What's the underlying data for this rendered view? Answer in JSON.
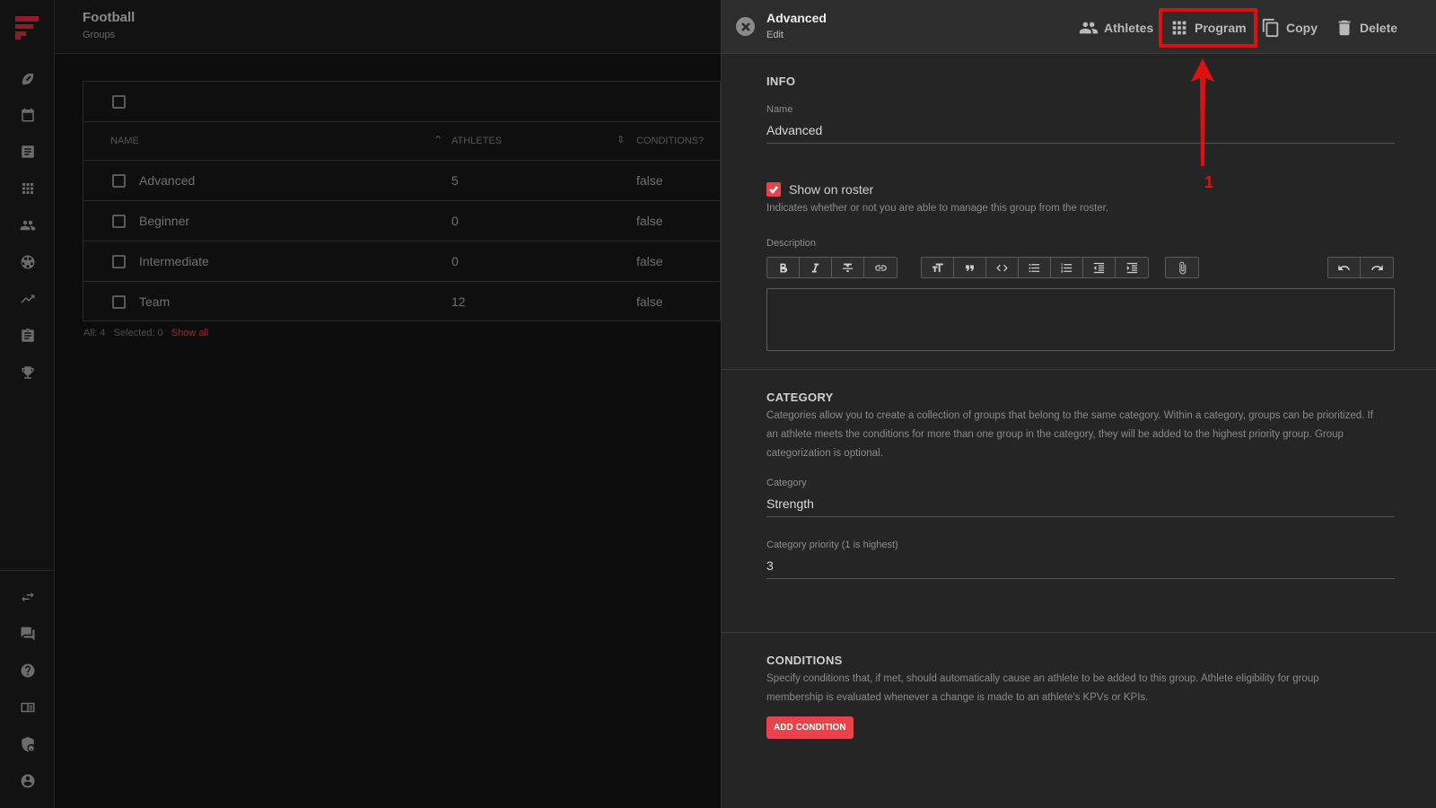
{
  "page": {
    "title": "Football",
    "subtitle": "Groups"
  },
  "rail": {
    "top_icons": [
      "football-icon",
      "calendar-icon",
      "notes-icon",
      "grid-icon",
      "people-icon",
      "soccer-ball-icon",
      "trending-icon",
      "clipboard-icon",
      "trophy-icon"
    ],
    "bottom_icons": [
      "swap-icon",
      "chat-icon",
      "help-icon",
      "book-icon",
      "security-icon",
      "account-icon"
    ]
  },
  "table": {
    "columns": [
      "Name",
      "Athletes",
      "Conditions?"
    ],
    "rows": [
      {
        "name": "Advanced",
        "athletes": "5",
        "conditions": "false"
      },
      {
        "name": "Beginner",
        "athletes": "0",
        "conditions": "false"
      },
      {
        "name": "Intermediate",
        "athletes": "0",
        "conditions": "false"
      },
      {
        "name": "Team",
        "athletes": "12",
        "conditions": "false"
      }
    ],
    "footer": {
      "all": "All: 4",
      "selected": "Selected: 0",
      "show_all": "Show all"
    }
  },
  "panel": {
    "title": "Advanced",
    "subtitle": "Edit",
    "actions": {
      "athletes": "Athletes",
      "program": "Program",
      "copy": "Copy",
      "delete": "Delete"
    },
    "annotation": {
      "number": "1",
      "color": "#e01010"
    },
    "info": {
      "heading": "INFO",
      "name_label": "Name",
      "name_value": "Advanced",
      "show_on_roster_label": "Show on roster",
      "show_on_roster_checked": true,
      "show_on_roster_help": "Indicates whether or not you are able to manage this group from the roster.",
      "description_label": "Description"
    },
    "category": {
      "heading": "CATEGORY",
      "help": "Categories allow you to create a collection of groups that belong to the same category. Within a category, groups can be prioritized. If an athlete meets the conditions for more than one group in the category, they will be added to the highest priority group. Group categorization is optional.",
      "category_label": "Category",
      "category_value": "Strength",
      "priority_label": "Category priority (1 is highest)",
      "priority_value": "3"
    },
    "conditions": {
      "heading": "CONDITIONS",
      "help": "Specify conditions that, if met, should automatically cause an athlete to be added to this group. Athlete eligibility for group membership is evaluated whenever a change is made to an athlete's KPVs or KPIs.",
      "add_button": "ADD CONDITION"
    }
  },
  "colors": {
    "accent": "#e8434b",
    "annotation": "#e01010",
    "panel_bg": "#252525"
  }
}
